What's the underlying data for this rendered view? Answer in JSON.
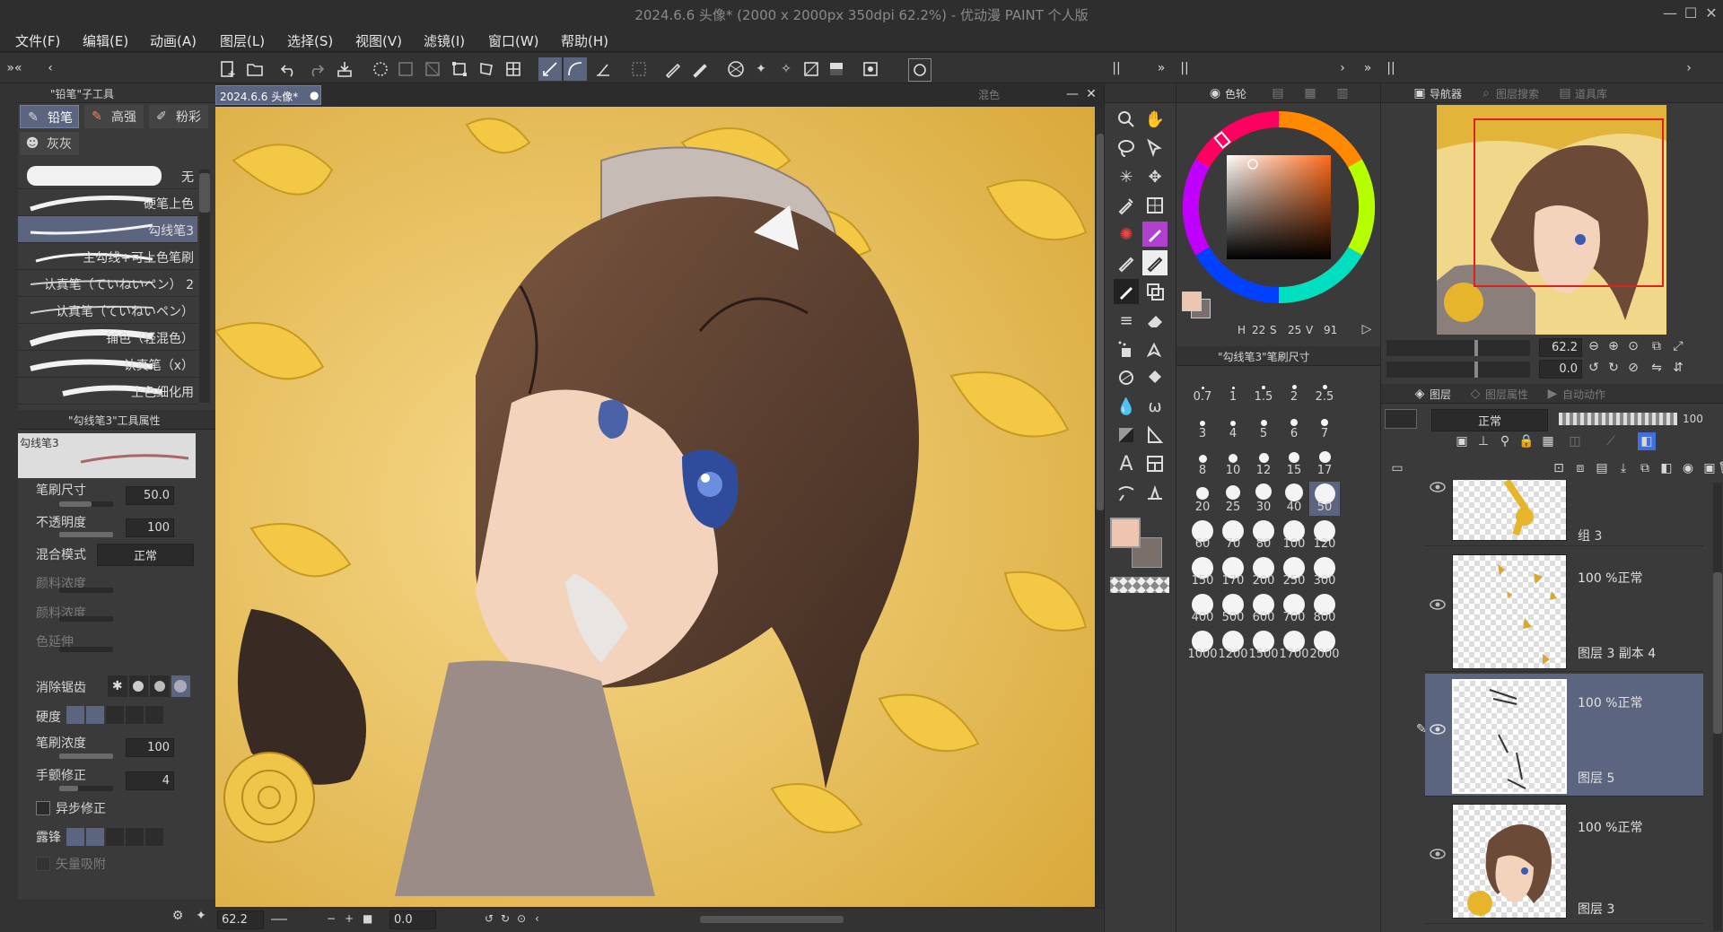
{
  "app": {
    "title": "2024.6.6 头像* (2000 x 2000px 350dpi 62.2%) - 优动漫 PAINT 个人版"
  },
  "menu": [
    "文件(F)",
    "编辑(E)",
    "动画(A)",
    "图层(L)",
    "选择(S)",
    "视图(V)",
    "滤镜(I)",
    "窗口(W)",
    "帮助(H)"
  ],
  "subtool": {
    "header": "\"铅笔\"子工具",
    "tabs": [
      "铅笔",
      "高强",
      "粉彩",
      "灰灰"
    ],
    "brushes": [
      "无",
      "硬笔上色",
      "勾线笔3",
      "主勾线+可上色笔刷",
      "认真笔（ていねいペン） 2",
      "认真笔（ていねいペン）",
      "铺色（轻混色）",
      "认真笔（x）",
      "上色细化用"
    ],
    "selected_brush": "勾线笔3"
  },
  "tool_property": {
    "header": "\"勾线笔3\"工具属性",
    "preview_label": "勾线笔3",
    "rows": [
      {
        "label": "笔刷尺寸",
        "value": "50.0"
      },
      {
        "label": "不透明度",
        "value": "100"
      },
      {
        "label": "混合模式",
        "value": "正常"
      },
      {
        "label": "颜料浓度",
        "value": ""
      },
      {
        "label": "颜料浓度",
        "value": ""
      },
      {
        "label": "色延伸",
        "value": ""
      },
      {
        "label": "消除锯齿",
        "value": ""
      },
      {
        "label": "硬度",
        "value": ""
      },
      {
        "label": "笔刷浓度",
        "value": "100"
      },
      {
        "label": "手颤修正",
        "value": "4"
      },
      {
        "label": "异步修正",
        "value": ""
      },
      {
        "label": "露锋",
        "value": ""
      },
      {
        "label": "矢量吸附",
        "value": ""
      }
    ]
  },
  "canvas": {
    "tab": "2024.6.6 头像*",
    "blend_label": "混色",
    "zoom": "62.2",
    "angle": "0.0"
  },
  "color": {
    "tabs": [
      "色轮"
    ],
    "hsv": {
      "h": "22",
      "s": "25",
      "v": "91"
    },
    "main_color": "#eec5ae",
    "sub_color": "#7a6f6b"
  },
  "brush_size": {
    "header": "\"勾线笔3\"笔刷尺寸",
    "sizes": [
      "0.7",
      "1",
      "1.5",
      "2",
      "2.5",
      "3",
      "4",
      "5",
      "6",
      "7",
      "8",
      "10",
      "12",
      "15",
      "17",
      "20",
      "25",
      "30",
      "40",
      "50",
      "60",
      "70",
      "80",
      "100",
      "120",
      "150",
      "170",
      "200",
      "250",
      "300",
      "400",
      "500",
      "600",
      "700",
      "800",
      "1000",
      "1200",
      "1500",
      "1700",
      "2000"
    ],
    "selected": "50"
  },
  "navigator": {
    "tabs": [
      "导航器",
      "图层搜索",
      "道具库"
    ],
    "zoom": "62.2",
    "angle": "0.0"
  },
  "layers": {
    "tabs": [
      "图层",
      "图层属性",
      "自动动作"
    ],
    "blend_mode": "正常",
    "opacity": "100",
    "items": [
      {
        "name": "组 3",
        "mode": ""
      },
      {
        "name": "图层 3 副本 4",
        "mode": "100 %正常"
      },
      {
        "name": "图层 5",
        "mode": "100 %正常",
        "selected": true
      },
      {
        "name": "图层 3",
        "mode": "100 %正常"
      }
    ]
  }
}
